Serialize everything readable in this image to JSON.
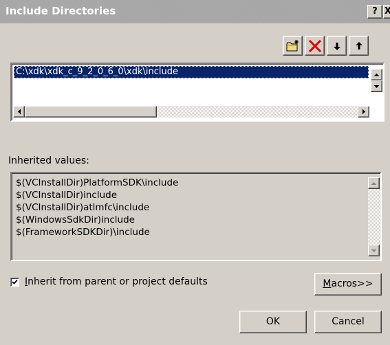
{
  "window": {
    "title": "Include Directories",
    "help_label": "?",
    "close_label": "X"
  },
  "toolbar": {
    "new_line": "new-folder-icon",
    "delete": "delete-icon",
    "move_down": "arrow-down-icon",
    "move_up": "arrow-up-icon"
  },
  "directories": {
    "items": [
      "C:\\xdk\\xdk_c_9_2_0_6_0\\xdk\\include"
    ],
    "selected_index": 0
  },
  "inherited": {
    "label": "Inherited values:",
    "items": [
      "$(VCInstallDir)PlatformSDK\\include",
      "$(VCInstallDir)include",
      "$(VCInstallDir)atlmfc\\include",
      "$(WindowsSdkDir)include",
      "$(FrameworkSDKDir)\\include"
    ]
  },
  "inherit_checkbox": {
    "label_hotkey": "I",
    "label_rest": "nherit from parent or project defaults",
    "checked": true
  },
  "buttons": {
    "macros_hotkey": "M",
    "macros_rest": "acros>>",
    "ok": "OK",
    "cancel": "Cancel"
  },
  "colors": {
    "dialog_bg": "#d4d0c8",
    "selection_bg": "#0a246a",
    "delete_red": "#e00000"
  }
}
